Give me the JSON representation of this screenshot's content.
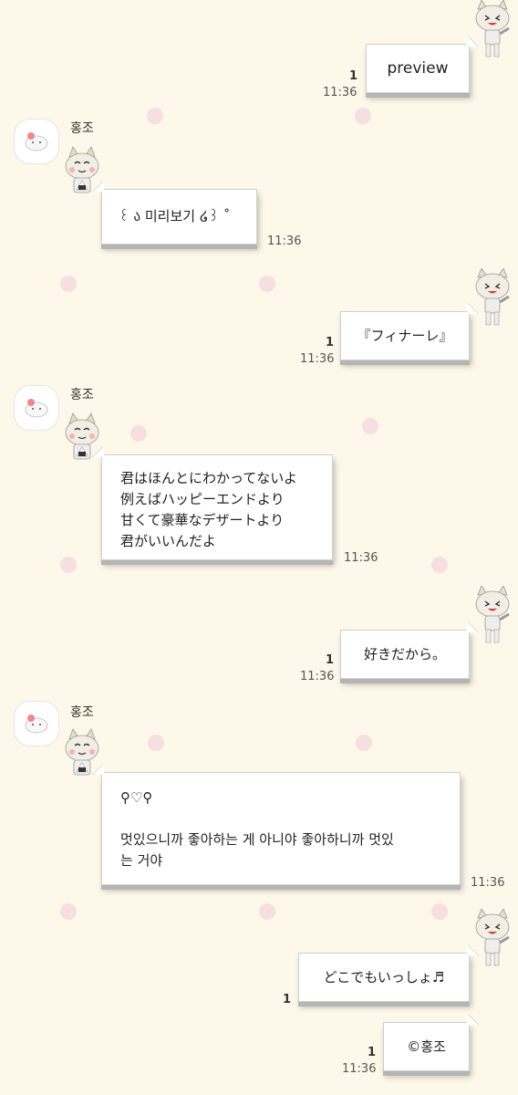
{
  "colors": {
    "background": "#fdf8e9",
    "dot": "#f6dfe0",
    "bubble": "#ffffff"
  },
  "messages": [
    {
      "dir": "sent",
      "text": "preview",
      "time": "11:36",
      "read": "1"
    },
    {
      "dir": "recv",
      "sender": "홍조",
      "text": "꒰ ა 미리보기 ໒꒱ ˚",
      "time": "11:36"
    },
    {
      "dir": "sent",
      "text": "『フィナーレ』",
      "time": "11:36",
      "read": "1"
    },
    {
      "dir": "recv",
      "sender": "홍조",
      "text": "君はほんとにわかってないよ\n例えばハッピーエンドより\n甘くて豪華なデザートより\n君がいいんだよ",
      "time": "11:36"
    },
    {
      "dir": "sent",
      "text": "好きだから。",
      "time": "11:36",
      "read": "1"
    },
    {
      "dir": "recv",
      "sender": "홍조",
      "text": "⚲♡⚲\n\n멋있으니까 좋아하는 게 아니야 좋아하니까 멋있\n는 거야",
      "time": "11:36"
    },
    {
      "dir": "sent",
      "text": "どこでもいっしょ♬",
      "read": "1"
    },
    {
      "dir": "sent",
      "text": "©홍조",
      "time": "11:36",
      "read": "1"
    }
  ]
}
